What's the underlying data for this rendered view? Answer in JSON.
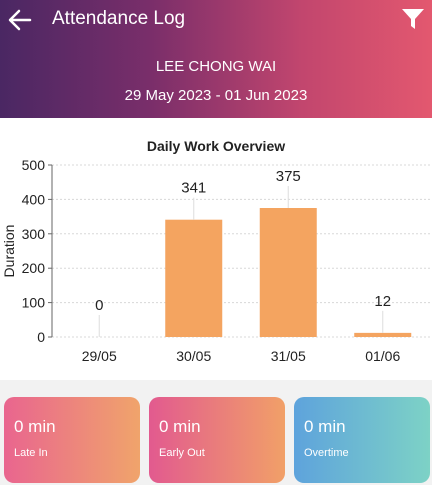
{
  "header": {
    "title": "Attendance Log",
    "employee_name": "LEE CHONG WAI",
    "date_range": "29 May 2023 - 01 Jun 2023",
    "back_icon": "arrow-left-icon",
    "filter_icon": "filter-icon"
  },
  "chart": {
    "title": "Daily Work Overview",
    "ylabel": "Duration"
  },
  "chart_data": {
    "type": "bar",
    "title": "Daily Work Overview",
    "xlabel": "",
    "ylabel": "Duration",
    "categories": [
      "29/05",
      "30/05",
      "31/05",
      "01/06"
    ],
    "values": [
      0,
      341,
      375,
      12
    ],
    "data_labels": [
      "0",
      "341",
      "375",
      "12"
    ],
    "ylim": [
      0,
      500
    ],
    "yticks": [
      "0",
      "100",
      "200",
      "300",
      "400",
      "500"
    ],
    "grid": true,
    "bar_color": "#f4a460"
  },
  "cards": [
    {
      "value": "0 min",
      "label": "Late In"
    },
    {
      "value": "0 min",
      "label": "Early Out"
    },
    {
      "value": "0 min",
      "label": "Overtime"
    }
  ]
}
